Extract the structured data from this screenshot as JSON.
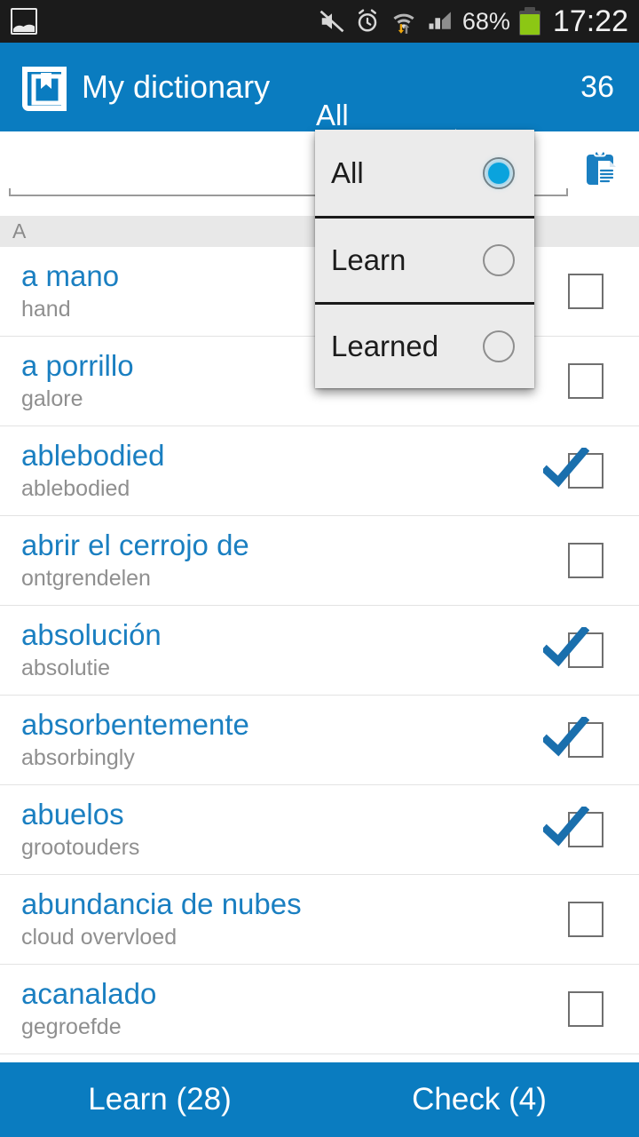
{
  "statusbar": {
    "notification_icon": "gallery-icon",
    "icons": [
      "mute-icon",
      "alarm-icon",
      "wifi-data-icon",
      "signal-icon"
    ],
    "battery_percent": "68%",
    "time": "17:22"
  },
  "actionbar": {
    "logo_icon": "book-bookmark-icon",
    "title": "My dictionary",
    "spinner_value": "All",
    "count": "36",
    "background": "#0a7cc0"
  },
  "search": {
    "value": "",
    "placeholder": "",
    "clipboard_icon": "clipboard-icon"
  },
  "list": {
    "section_header": "A",
    "rows": [
      {
        "word": "a mano",
        "translation": "hand",
        "checked": false
      },
      {
        "word": "a porrillo",
        "translation": "galore",
        "checked": false
      },
      {
        "word": "ablebodied",
        "translation": "ablebodied",
        "checked": true
      },
      {
        "word": "abrir el cerrojo de",
        "translation": "ontgrendelen",
        "checked": false
      },
      {
        "word": "absolución",
        "translation": "absolutie",
        "checked": true
      },
      {
        "word": "absorbentemente",
        "translation": "absorbingly",
        "checked": true
      },
      {
        "word": "abuelos",
        "translation": "grootouders",
        "checked": true
      },
      {
        "word": "abundancia de nubes",
        "translation": "cloud overvloed",
        "checked": false
      },
      {
        "word": "acanalado",
        "translation": "gegroefde",
        "checked": false
      }
    ]
  },
  "dropdown": {
    "visible": true,
    "selected": "All",
    "options": [
      {
        "label": "All",
        "selected": true
      },
      {
        "label": "Learn",
        "selected": false
      },
      {
        "label": "Learned",
        "selected": false
      }
    ]
  },
  "bottombar": {
    "learn_label": "Learn (28)",
    "check_label": "Check (4)"
  },
  "colors": {
    "accent": "#0a7cc0",
    "word_text": "#1a7fc1",
    "translation_text": "#8f8f8f",
    "section_bg": "#e8e8e8",
    "radio_selected": "#0aa3dd",
    "battery_green": "#8cc714"
  }
}
